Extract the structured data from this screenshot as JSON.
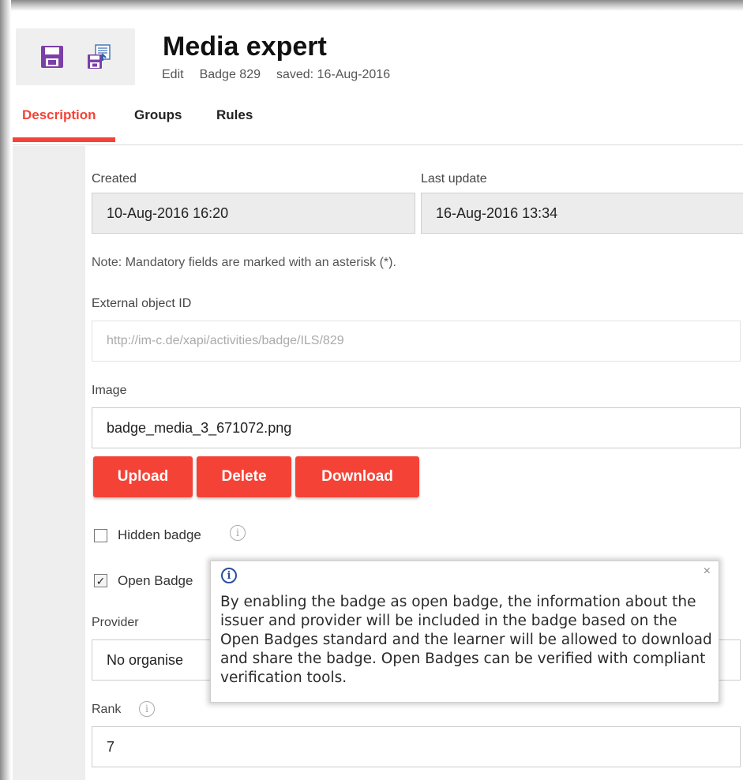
{
  "header": {
    "title": "Media expert",
    "meta": {
      "mode": "Edit",
      "badge": "Badge 829",
      "saved": "saved: 16-Aug-2016"
    }
  },
  "toolbar": {
    "save_icon": "floppy-disk-icon",
    "save_upload_icon": "save-upload-icon",
    "accent": "#7b3fa8"
  },
  "tabs": [
    {
      "label": "Description",
      "active": true
    },
    {
      "label": "Groups",
      "active": false
    },
    {
      "label": "Rules",
      "active": false
    }
  ],
  "form": {
    "created_label": "Created",
    "created_value": "10-Aug-2016 16:20",
    "last_update_label": "Last update",
    "last_update_value": "16-Aug-2016 13:34",
    "note": "Note: Mandatory fields are marked with an asterisk (*).",
    "external_id_label": "External object ID",
    "external_id_value": "http://im-c.de/xapi/activities/badge/ILS/829",
    "image_label": "Image",
    "image_value": "badge_media_3_671072.png",
    "buttons": {
      "upload": "Upload",
      "delete": "Delete",
      "download": "Download"
    },
    "hidden_badge_label": "Hidden badge",
    "hidden_badge_checked": false,
    "open_badge_label": "Open Badge",
    "open_badge_checked": true,
    "provider_label": "Provider",
    "provider_value": "No organise",
    "rank_label": "Rank",
    "rank_value": "7"
  },
  "tooltip": {
    "text": "By enabling the badge as open badge, the information about the issuer and provider will be included in the badge based on the Open Badges standard and the learner will be allowed to download and share the badge. Open Badges can be verified with compliant verification tools.",
    "close": "×"
  },
  "colors": {
    "accent_red": "#f44336",
    "info_blue": "#2a4ea0"
  }
}
